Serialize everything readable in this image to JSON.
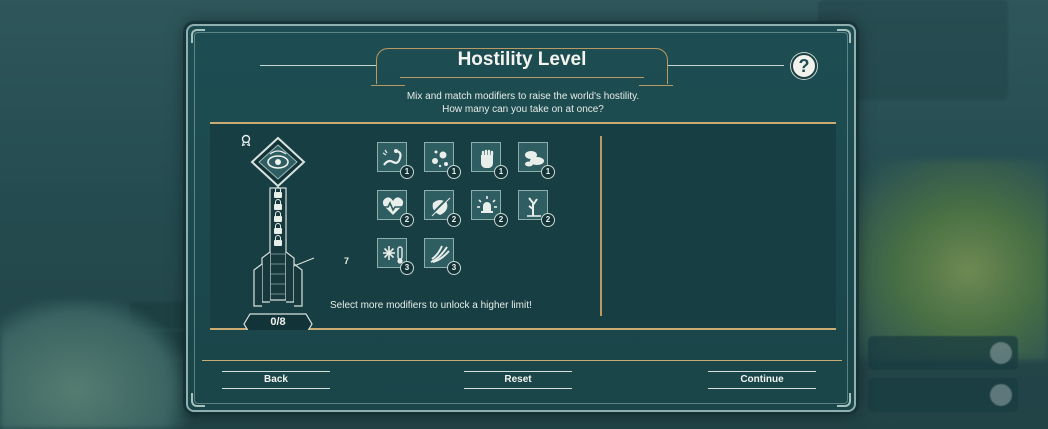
{
  "dialog": {
    "title": "Hostility Level",
    "help_label": "?",
    "subtitle_lines": [
      "Mix and match modifiers to raise the world's hostility.",
      "How many can you take on at once?"
    ]
  },
  "hostility_meter": {
    "count_label": "0/8",
    "current": 0,
    "max": 8,
    "marker_value": "7",
    "locked_levels": 5
  },
  "modifiers": [
    {
      "icon": "serpent-icon",
      "cost": "1"
    },
    {
      "icon": "spores-icon",
      "cost": "1"
    },
    {
      "icon": "fist-icon",
      "cost": "1"
    },
    {
      "icon": "clouds-icon",
      "cost": "1"
    },
    {
      "icon": "heartbeat-icon",
      "cost": "2"
    },
    {
      "icon": "no-food-icon",
      "cost": "2"
    },
    {
      "icon": "alarm-icon",
      "cost": "2"
    },
    {
      "icon": "dead-tree-icon",
      "cost": "2"
    },
    {
      "icon": "cold-icon",
      "cost": "3"
    },
    {
      "icon": "claw-icon",
      "cost": "3"
    }
  ],
  "unlock_hint": "Select more modifiers to unlock a higher limit!",
  "footer": {
    "back_label": "Back",
    "reset_label": "Reset",
    "continue_label": "Continue"
  },
  "colors": {
    "dialog_bg": "#1d4d52",
    "panel_bg": "#173e43",
    "gold_accent": "#c9ab73",
    "text": "#f3f4ef"
  }
}
